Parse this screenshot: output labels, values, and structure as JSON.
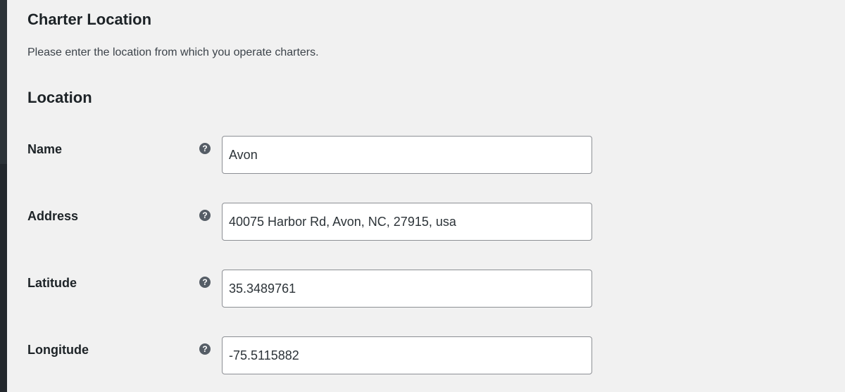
{
  "section": {
    "title": "Charter Location",
    "description": "Please enter the location from which you operate charters."
  },
  "subsection": {
    "title": "Location"
  },
  "fields": [
    {
      "label": "Name",
      "value": "Avon",
      "help_icon": "question-circle-icon"
    },
    {
      "label": "Address",
      "value": "40075 Harbor Rd, Avon, NC, 27915, usa",
      "help_icon": "question-circle-icon"
    },
    {
      "label": "Latitude",
      "value": "35.3489761",
      "help_icon": "question-circle-icon"
    },
    {
      "label": "Longitude",
      "value": "-75.5115882",
      "help_icon": "question-circle-icon"
    }
  ],
  "help_glyph": "?",
  "colors": {
    "background": "#f1f1f1",
    "admin_sidebar": "#2c3338",
    "input_border": "#8c8f94",
    "help_icon": "#555d66"
  }
}
